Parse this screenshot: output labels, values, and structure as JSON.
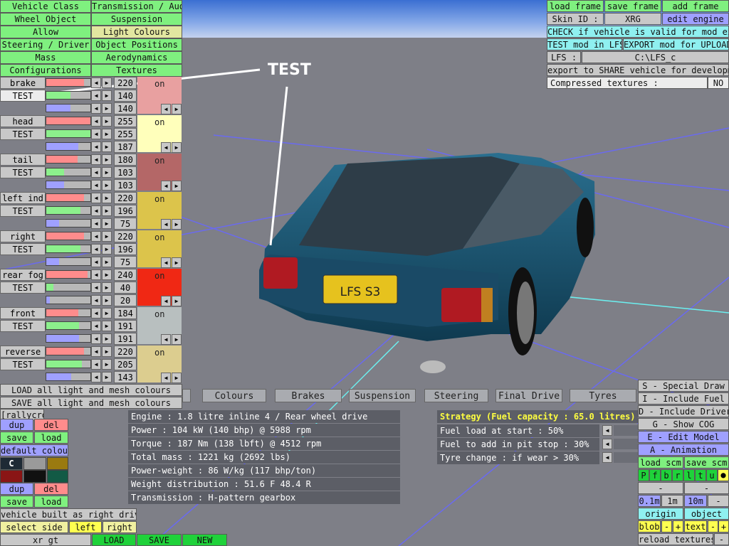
{
  "viewport_label": "TEST",
  "left_menu": [
    [
      "Vehicle Class",
      "Transmission / Audio"
    ],
    [
      "Wheel Object",
      "Suspension"
    ],
    [
      "Allow",
      "Light Colours"
    ],
    [
      "Steering / Driver",
      "Object Positions"
    ],
    [
      "Mass",
      "Aerodynamics"
    ],
    [
      "Configurations",
      "Textures"
    ]
  ],
  "lights": [
    {
      "name": "brake",
      "sub": "TEST",
      "vals": [
        "220",
        "140",
        "140"
      ],
      "state": "on",
      "color": "#e8a0a0"
    },
    {
      "name": "head",
      "sub": "TEST",
      "vals": [
        "255",
        "255",
        "187"
      ],
      "state": "on",
      "color": "#ffffbb"
    },
    {
      "name": "tail",
      "sub": "TEST",
      "vals": [
        "180",
        "103",
        "103"
      ],
      "state": "on",
      "color": "#b46767"
    },
    {
      "name": "left ind",
      "sub": "TEST",
      "vals": [
        "220",
        "196",
        "75"
      ],
      "state": "on",
      "color": "#dcc44b"
    },
    {
      "name": "right ind",
      "sub": "TEST",
      "vals": [
        "220",
        "196",
        "75"
      ],
      "state": "on",
      "color": "#dcc44b"
    },
    {
      "name": "rear fog",
      "sub": "TEST",
      "vals": [
        "240",
        "40",
        "20"
      ],
      "state": "on",
      "color": "#f02814"
    },
    {
      "name": "front fog",
      "sub": "TEST",
      "vals": [
        "184",
        "191",
        "191"
      ],
      "state": "on",
      "color": "#b8bfbf"
    },
    {
      "name": "reverse",
      "sub": "TEST",
      "vals": [
        "220",
        "205",
        "143"
      ],
      "state": "on",
      "color": "#dccd8f"
    }
  ],
  "load_all": "LOAD all light and mesh colours",
  "save_all": "SAVE all light and mesh colours",
  "rallycross": "[rallycross]",
  "dup": "dup",
  "del": "del",
  "save": "save",
  "load": "load",
  "default_colours": "default colours",
  "c_label": "C",
  "built_as": "vehicle built as right drive",
  "select_side": "select side",
  "left": "left",
  "right": "right",
  "car_name": "xr gt",
  "LOAD": "LOAD",
  "SAVE": "SAVE",
  "NEW": "NEW",
  "tabs": [
    "Colours",
    "Brakes",
    "Suspension",
    "Steering",
    "Final Drive",
    "Tyres"
  ],
  "info": [
    "Engine : 1.8 litre inline 4 / Rear wheel drive",
    "Power : 104 kW (140 bhp) @ 5988 rpm",
    "Torque : 187 Nm (138 lbft) @ 4512 rpm",
    "Total mass : 1221 kg (2692 lbs)",
    "Power-weight : 86 W/kg (117 bhp/ton)",
    "Weight distribution : 51.6 F  48.4 R",
    "Transmission : H-pattern gearbox"
  ],
  "strategy": {
    "title": "Strategy (Fuel capacity : 65.0 litres)",
    "rows": [
      "Fuel load at start : 50%",
      "Fuel to add in pit stop : 30%",
      "Tyre change : if wear > 30%"
    ]
  },
  "top_right": {
    "load_frame": "load frame",
    "save_frame": "save frame",
    "add_frame": "add frame",
    "skin_label": "Skin ID :",
    "skin_value": "XRG",
    "edit_engine": "edit engine",
    "check": "CHECK if vehicle is valid for mod export",
    "test_mod": "TEST mod in LFS",
    "export_mod": "EXPORT mod for UPLOAD",
    "lfs_label": "LFS :",
    "lfs_path": "C:\\LFS_c",
    "export_share": "export to SHARE vehicle for development",
    "compressed": "Compressed textures :",
    "compressed_value": "NO"
  },
  "bottom_right": {
    "special": "S - Special Draw",
    "fuel": "I - Include Fuel",
    "driver": "D - Include Driver",
    "cog": "G - Show COG",
    "edit_model": "E - Edit Model",
    "animation": "A - Animation",
    "load_scm": "load scm",
    "save_scm": "save scm",
    "letters": [
      "P",
      "f",
      "b",
      "r",
      "l",
      "t",
      "u"
    ],
    "minus": "-",
    "plus": "+",
    "steps": [
      "0.1m",
      "1m",
      "10m"
    ],
    "origin": "origin",
    "object": "object",
    "blob": "blob",
    "text": "text",
    "reload": "reload textures"
  },
  "plate": "LFS S3"
}
